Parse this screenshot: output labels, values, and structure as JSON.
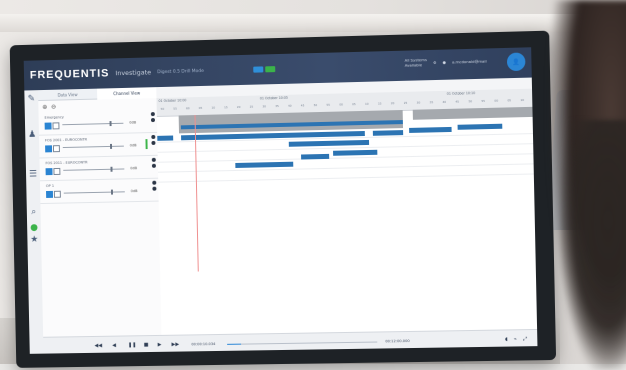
{
  "header": {
    "brand": "FREQUENTIS",
    "product": "Investigate",
    "session": "Digest 0.5 Drill Mode",
    "user_line1": "All Systems",
    "user_line2": "Available",
    "user_name": "a.mcdonald@mail"
  },
  "tabs": [
    {
      "label": "Data View"
    },
    {
      "label": "Channel View"
    }
  ],
  "channels": [
    {
      "name": "Emergency",
      "vol": "0dB"
    },
    {
      "name": "FOS 2001 - EUROCONTR",
      "vol": "0dB"
    },
    {
      "name": "FOS 2011 - EUROCONTR",
      "vol": "0dB"
    },
    {
      "name": "OP 1",
      "vol": "0dB"
    }
  ],
  "timeline": {
    "dates": [
      "01 October 10:00",
      "01 October 10:05",
      "01 October 10:10"
    ],
    "ticks": [
      "50",
      "55",
      "60",
      "05",
      "10",
      "15",
      "20",
      "25",
      "30",
      "35",
      "40",
      "45",
      "50",
      "55",
      "00",
      "05",
      "10",
      "15",
      "20",
      "25",
      "30",
      "35",
      "40",
      "45",
      "50",
      "55",
      "00",
      "05",
      "10"
    ]
  },
  "playback": {
    "time_current": "00:00:10.034",
    "time_end": "00:12:00.000"
  },
  "colors": {
    "accent": "#2b86d6",
    "segment": "#2c74b3",
    "header": "#2e3d57",
    "ok": "#3bb34a"
  }
}
